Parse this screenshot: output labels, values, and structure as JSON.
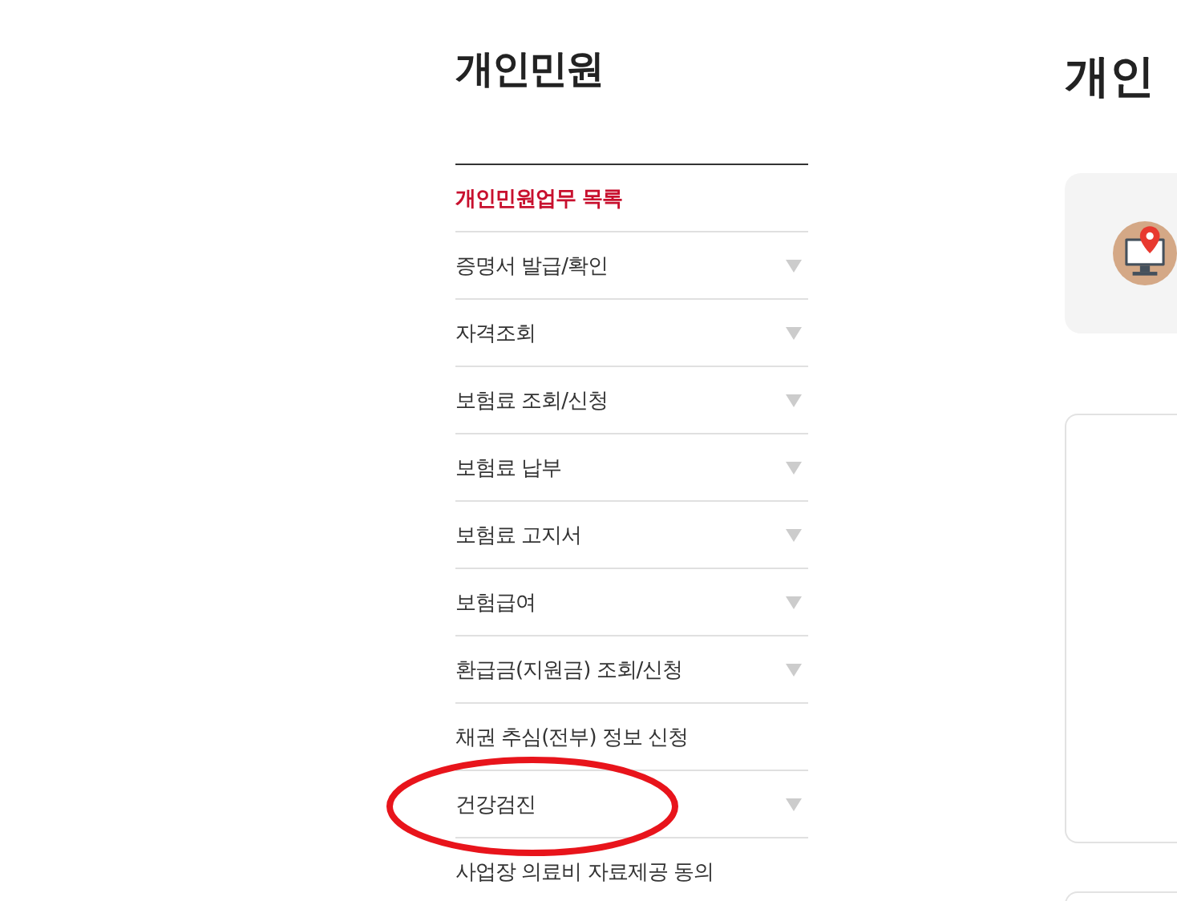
{
  "sidebar": {
    "title": "개인민원",
    "items": [
      {
        "label": "개인민원업무 목록",
        "selected": true,
        "expandable": false,
        "circled": false
      },
      {
        "label": "증명서 발급/확인",
        "selected": false,
        "expandable": true,
        "circled": false
      },
      {
        "label": "자격조회",
        "selected": false,
        "expandable": true,
        "circled": false
      },
      {
        "label": "보험료 조회/신청",
        "selected": false,
        "expandable": true,
        "circled": false
      },
      {
        "label": "보험료 납부",
        "selected": false,
        "expandable": true,
        "circled": false
      },
      {
        "label": "보험료 고지서",
        "selected": false,
        "expandable": true,
        "circled": false
      },
      {
        "label": "보험급여",
        "selected": false,
        "expandable": true,
        "circled": false
      },
      {
        "label": "환급금(지원금) 조회/신청",
        "selected": false,
        "expandable": true,
        "circled": false
      },
      {
        "label": "채권 추심(전부) 정보 신청",
        "selected": false,
        "expandable": false,
        "circled": false
      },
      {
        "label": "건강검진",
        "selected": false,
        "expandable": true,
        "circled": true
      },
      {
        "label": "사업장 의료비 자료제공 동의",
        "selected": false,
        "expandable": false,
        "circled": false
      }
    ]
  },
  "main": {
    "heading": "개인"
  }
}
